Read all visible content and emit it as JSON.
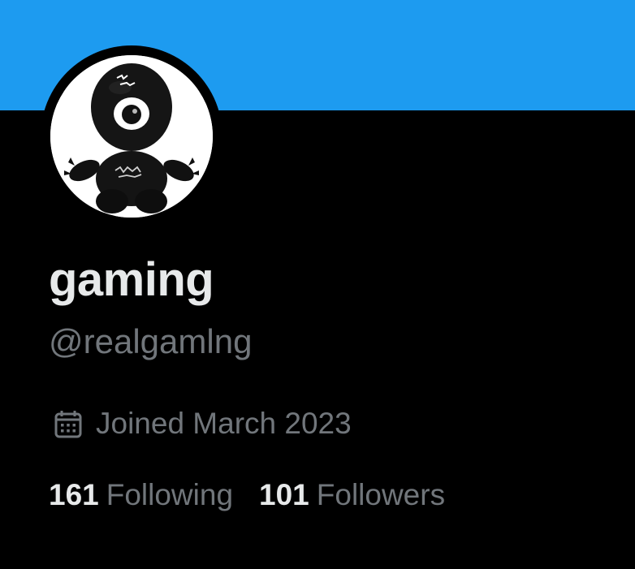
{
  "colors": {
    "banner": "#1d9bf0",
    "background": "#000000",
    "primary_text": "#e7e9ea",
    "secondary_text": "#71767b"
  },
  "profile": {
    "avatar_icon": "one-eyed-plush-avatar",
    "display_name": "gaming",
    "handle": "@realgamlng",
    "joined_icon": "calendar-icon",
    "joined": "Joined March 2023"
  },
  "stats": {
    "following_count": "161",
    "following_label": "Following",
    "followers_count": "101",
    "followers_label": "Followers"
  }
}
